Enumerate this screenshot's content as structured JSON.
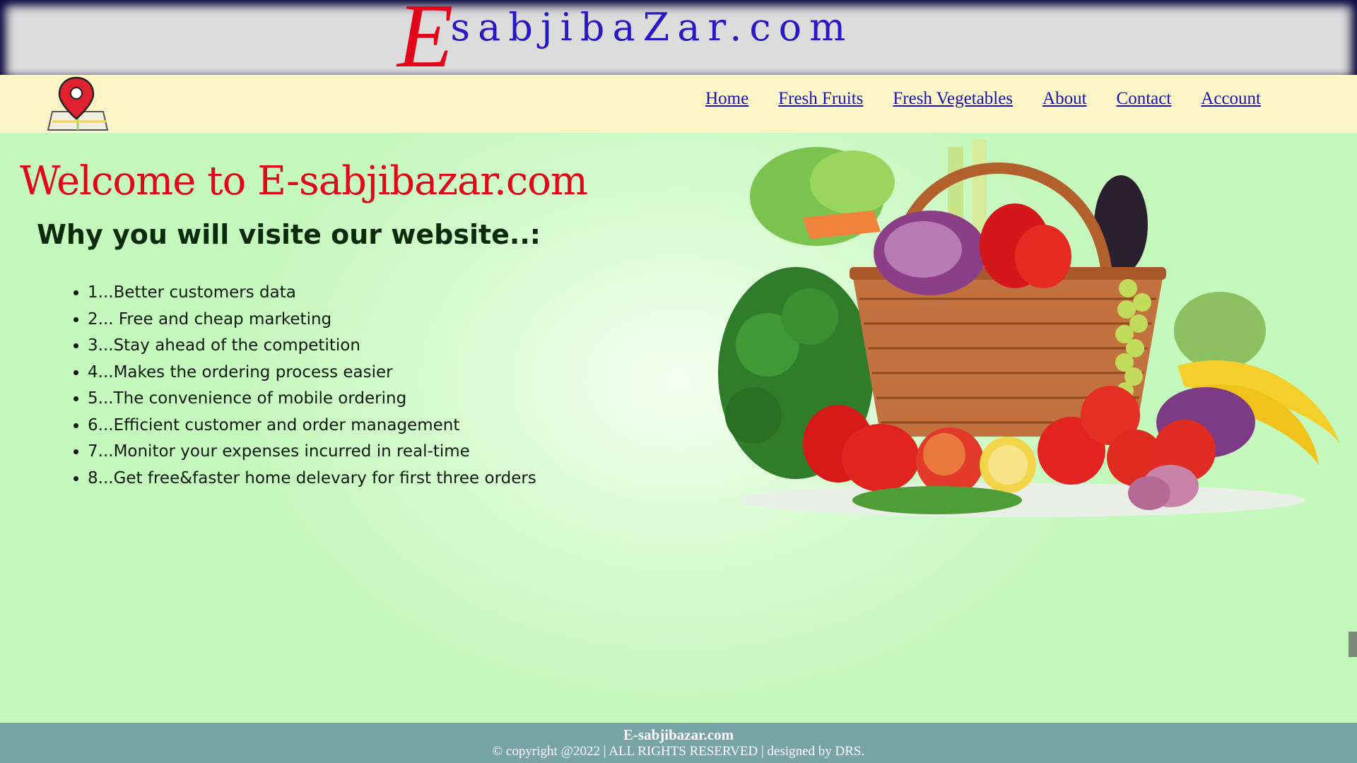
{
  "brand": {
    "logo_initial": "E",
    "logo_rest": "sabjibaZar.com",
    "accent": "#e3061a",
    "logo_color": "#2a18c8"
  },
  "header": {
    "location_icon": "map-pin-icon",
    "nav": [
      {
        "label": "Home"
      },
      {
        "label": "Fresh Fruits"
      },
      {
        "label": "Fresh Vegetables"
      },
      {
        "label": "About"
      },
      {
        "label": "Contact"
      },
      {
        "label": "Account"
      }
    ]
  },
  "main": {
    "welcome": "Welcome to E-sabjibazar.com",
    "why_title": "Why you will visite our website..:",
    "reasons": [
      "1...Better customers data",
      "2... Free and cheap marketing",
      "3...Stay ahead of the competition",
      "4...Makes the ordering process easier",
      "5...The convenience of mobile ordering",
      "6...Efficient customer and order management",
      "7...Monitor your expenses incurred in real-time",
      "8...Get free&faster home delevary for first three orders"
    ],
    "hero_image": "vegetable-basket-illustration"
  },
  "footer": {
    "title": "E-sabjibazar.com",
    "copyright": "© copyright @2022 | ALL RIGHTS RESERVED | designed by DRS."
  }
}
